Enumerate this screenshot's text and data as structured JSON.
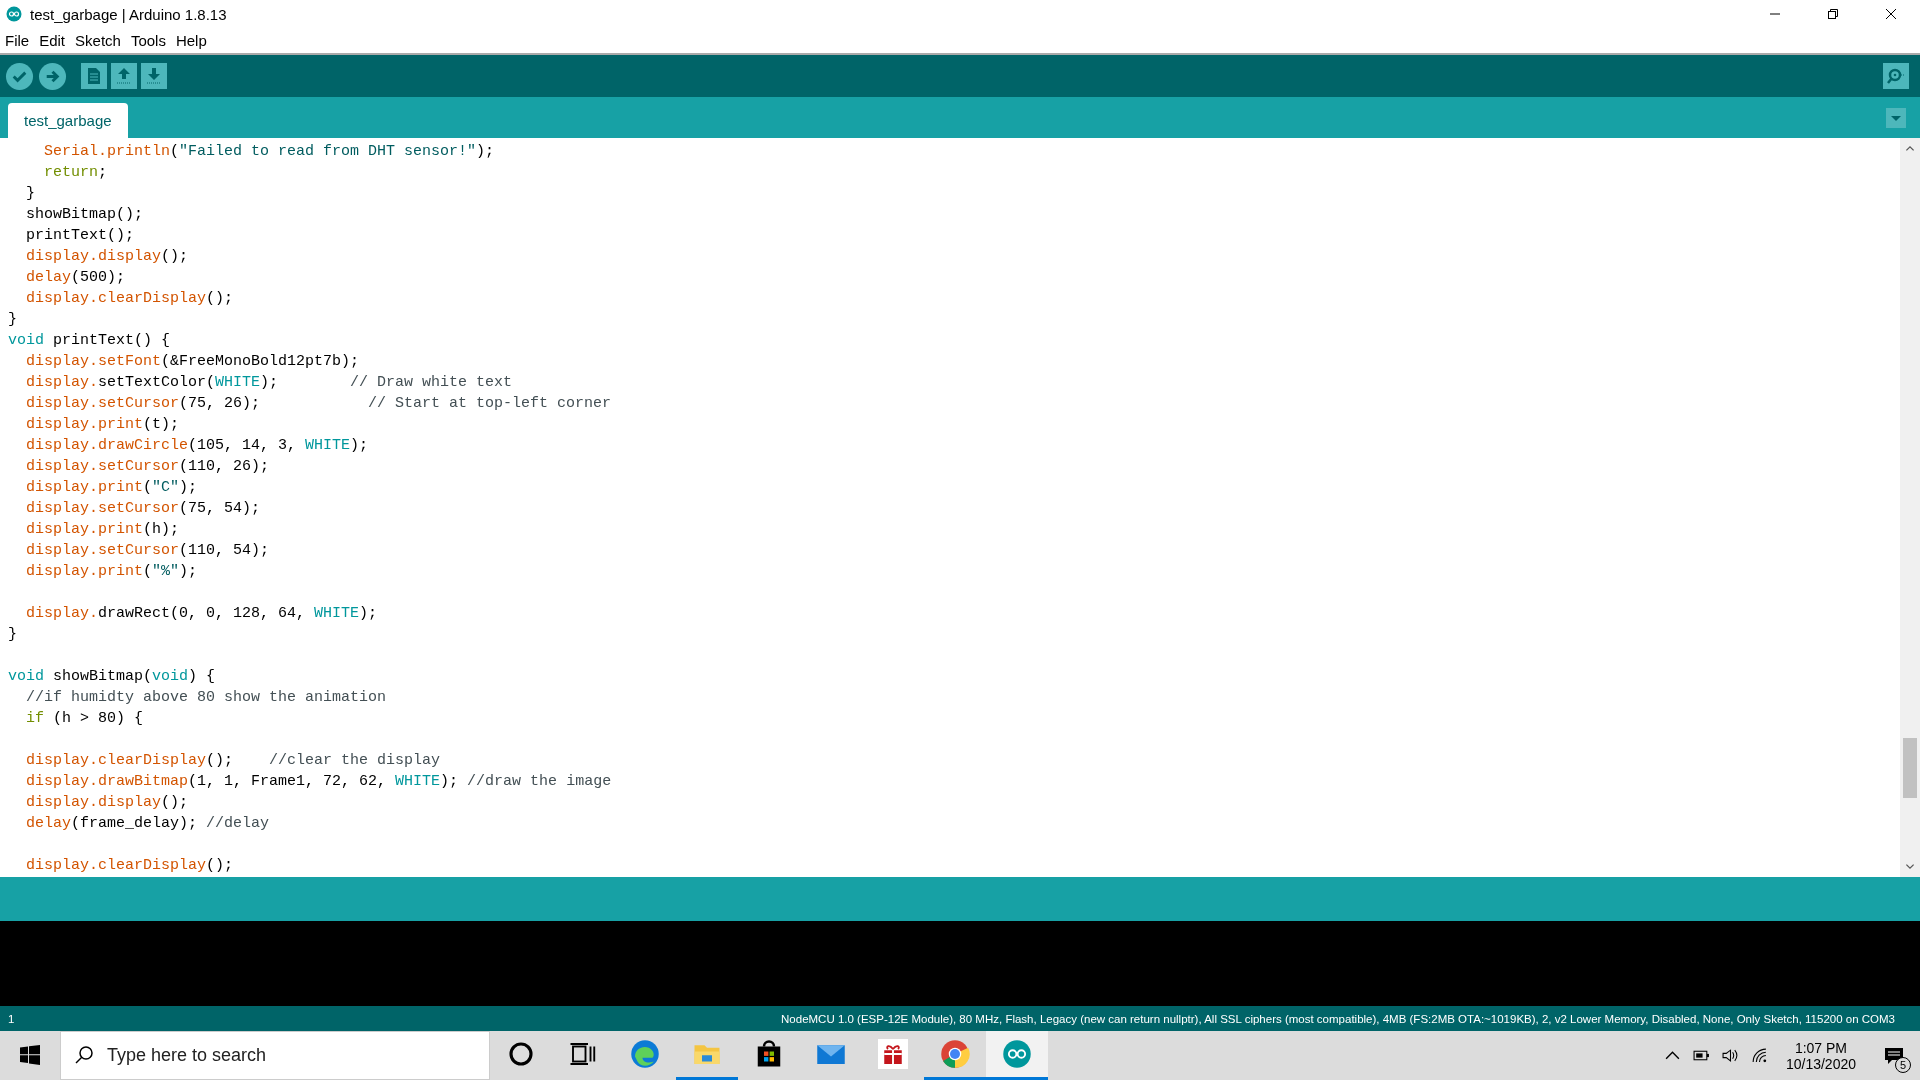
{
  "window": {
    "title": "test_garbage | Arduino 1.8.13"
  },
  "menu": [
    "File",
    "Edit",
    "Sketch",
    "Tools",
    "Help"
  ],
  "tabs": [
    {
      "label": "test_garbage",
      "selected": true
    }
  ],
  "code_lines": [
    {
      "kind": "code",
      "tokens": [
        {
          "kind": "fn",
          "text": "    Serial.println"
        },
        {
          "kind": "plain",
          "text": "("
        },
        {
          "kind": "str",
          "text": "\"Failed to read from DHT sensor!\""
        },
        {
          "kind": "plain",
          "text": ");"
        }
      ]
    },
    {
      "kind": "code",
      "tokens": [
        {
          "kind": "ctl",
          "text": "    return"
        },
        {
          "kind": "plain",
          "text": ";"
        }
      ]
    },
    {
      "kind": "code",
      "tokens": [
        {
          "kind": "plain",
          "text": "  }"
        }
      ]
    },
    {
      "kind": "code",
      "tokens": [
        {
          "kind": "plain",
          "text": "  showBitmap();"
        }
      ]
    },
    {
      "kind": "code",
      "tokens": [
        {
          "kind": "plain",
          "text": "  printText();"
        }
      ]
    },
    {
      "kind": "code",
      "tokens": [
        {
          "kind": "fn",
          "text": "  display.display"
        },
        {
          "kind": "plain",
          "text": "();"
        }
      ]
    },
    {
      "kind": "code",
      "tokens": [
        {
          "kind": "fn",
          "text": "  delay"
        },
        {
          "kind": "plain",
          "text": "(500);"
        }
      ]
    },
    {
      "kind": "code",
      "tokens": [
        {
          "kind": "fn",
          "text": "  display.clearDisplay"
        },
        {
          "kind": "plain",
          "text": "();"
        }
      ]
    },
    {
      "kind": "code",
      "tokens": [
        {
          "kind": "plain",
          "text": "}"
        }
      ]
    },
    {
      "kind": "code",
      "tokens": [
        {
          "kind": "type",
          "text": "void"
        },
        {
          "kind": "plain",
          "text": " printText() {"
        }
      ]
    },
    {
      "kind": "code",
      "tokens": [
        {
          "kind": "fn",
          "text": "  display.setFont"
        },
        {
          "kind": "plain",
          "text": "(&FreeMonoBold12pt7b);"
        }
      ]
    },
    {
      "kind": "code",
      "tokens": [
        {
          "kind": "fn",
          "text": "  display."
        },
        {
          "kind": "plain",
          "text": "setTextColor("
        },
        {
          "kind": "type",
          "text": "WHITE"
        },
        {
          "kind": "plain",
          "text": ");        "
        },
        {
          "kind": "comment",
          "text": "// Draw white text"
        }
      ]
    },
    {
      "kind": "code",
      "tokens": [
        {
          "kind": "fn",
          "text": "  display.setCursor"
        },
        {
          "kind": "plain",
          "text": "(75, 26);            "
        },
        {
          "kind": "comment",
          "text": "// Start at top-left corner"
        }
      ]
    },
    {
      "kind": "code",
      "tokens": [
        {
          "kind": "fn",
          "text": "  display.print"
        },
        {
          "kind": "plain",
          "text": "(t);"
        }
      ]
    },
    {
      "kind": "code",
      "tokens": [
        {
          "kind": "fn",
          "text": "  display.drawCircle"
        },
        {
          "kind": "plain",
          "text": "(105, 14, 3, "
        },
        {
          "kind": "type",
          "text": "WHITE"
        },
        {
          "kind": "plain",
          "text": ");"
        }
      ]
    },
    {
      "kind": "code",
      "tokens": [
        {
          "kind": "fn",
          "text": "  display.setCursor"
        },
        {
          "kind": "plain",
          "text": "(110, 26);"
        }
      ]
    },
    {
      "kind": "code",
      "tokens": [
        {
          "kind": "fn",
          "text": "  display.print"
        },
        {
          "kind": "plain",
          "text": "("
        },
        {
          "kind": "str",
          "text": "\"C\""
        },
        {
          "kind": "plain",
          "text": ");"
        }
      ]
    },
    {
      "kind": "code",
      "tokens": [
        {
          "kind": "fn",
          "text": "  display.setCursor"
        },
        {
          "kind": "plain",
          "text": "(75, 54);"
        }
      ]
    },
    {
      "kind": "code",
      "tokens": [
        {
          "kind": "fn",
          "text": "  display.print"
        },
        {
          "kind": "plain",
          "text": "(h);"
        }
      ]
    },
    {
      "kind": "code",
      "tokens": [
        {
          "kind": "fn",
          "text": "  display.setCursor"
        },
        {
          "kind": "plain",
          "text": "(110, 54);"
        }
      ]
    },
    {
      "kind": "code",
      "tokens": [
        {
          "kind": "fn",
          "text": "  display.print"
        },
        {
          "kind": "plain",
          "text": "("
        },
        {
          "kind": "str",
          "text": "\"%\""
        },
        {
          "kind": "plain",
          "text": ");"
        }
      ]
    },
    {
      "kind": "blank"
    },
    {
      "kind": "code",
      "tokens": [
        {
          "kind": "fn",
          "text": "  display."
        },
        {
          "kind": "plain",
          "text": "drawRect(0, 0, 128, 64, "
        },
        {
          "kind": "type",
          "text": "WHITE"
        },
        {
          "kind": "plain",
          "text": ");"
        }
      ]
    },
    {
      "kind": "code",
      "tokens": [
        {
          "kind": "plain",
          "text": "}"
        }
      ]
    },
    {
      "kind": "blank"
    },
    {
      "kind": "code",
      "tokens": [
        {
          "kind": "type",
          "text": "void"
        },
        {
          "kind": "plain",
          "text": " showBitmap("
        },
        {
          "kind": "type",
          "text": "void"
        },
        {
          "kind": "plain",
          "text": ") {"
        }
      ]
    },
    {
      "kind": "code",
      "tokens": [
        {
          "kind": "comment",
          "text": "  //if humidty above 80 show the animation"
        }
      ]
    },
    {
      "kind": "code",
      "tokens": [
        {
          "kind": "ctl",
          "text": "  if"
        },
        {
          "kind": "plain",
          "text": " (h > 80) {"
        }
      ]
    },
    {
      "kind": "blank"
    },
    {
      "kind": "code",
      "tokens": [
        {
          "kind": "fn",
          "text": "  display.clearDisplay"
        },
        {
          "kind": "plain",
          "text": "();    "
        },
        {
          "kind": "comment",
          "text": "//clear the display"
        }
      ]
    },
    {
      "kind": "code",
      "tokens": [
        {
          "kind": "fn",
          "text": "  display.drawBitmap"
        },
        {
          "kind": "plain",
          "text": "(1, 1, Frame1, 72, 62, "
        },
        {
          "kind": "type",
          "text": "WHITE"
        },
        {
          "kind": "plain",
          "text": "); "
        },
        {
          "kind": "comment",
          "text": "//draw the image"
        }
      ]
    },
    {
      "kind": "code",
      "tokens": [
        {
          "kind": "fn",
          "text": "  display.display"
        },
        {
          "kind": "plain",
          "text": "();"
        }
      ]
    },
    {
      "kind": "code",
      "tokens": [
        {
          "kind": "fn",
          "text": "  delay"
        },
        {
          "kind": "plain",
          "text": "(frame_delay); "
        },
        {
          "kind": "comment",
          "text": "//delay"
        }
      ]
    },
    {
      "kind": "blank"
    },
    {
      "kind": "code",
      "tokens": [
        {
          "kind": "fn",
          "text": "  display.clearDisplay"
        },
        {
          "kind": "plain",
          "text": "();"
        }
      ]
    }
  ],
  "status_bar": {
    "line": "1",
    "board": "NodeMCU 1.0 (ESP-12E Module), 80 MHz, Flash, Legacy (new can return nullptr), All SSL ciphers (most compatible), 4MB (FS:2MB OTA:~1019KB), 2, v2 Lower Memory, Disabled, None, Only Sketch, 115200 on COM3"
  },
  "taskbar": {
    "search": {
      "placeholder": "Type here to search"
    },
    "apps": [
      {
        "kind": "edge",
        "running": false,
        "active": false
      },
      {
        "kind": "explorer",
        "running": true,
        "active": false
      },
      {
        "kind": "store",
        "running": false,
        "active": false
      },
      {
        "kind": "mail",
        "running": false,
        "active": false
      },
      {
        "kind": "gift",
        "running": false,
        "active": false
      },
      {
        "kind": "chrome",
        "running": true,
        "active": false
      },
      {
        "kind": "arduino",
        "running": true,
        "active": true
      }
    ],
    "time": "1:07 PM",
    "date": "10/13/2020",
    "notifications": "5"
  }
}
